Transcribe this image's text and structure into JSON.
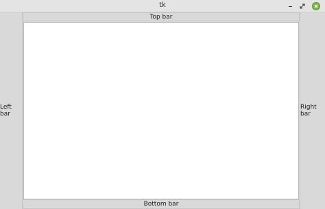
{
  "window": {
    "title": "tk",
    "buttons": {
      "minimize": "minimize",
      "maximize": "maximize",
      "close": "close"
    },
    "icons": {
      "minimize": "minimize-icon",
      "maximize": "maximize-icon",
      "close": "close-icon"
    },
    "colors": {
      "close": "#7cb34a"
    }
  },
  "bars": {
    "top": "Top bar",
    "bottom": "Bottom bar",
    "left": "Left bar",
    "right": "Right bar"
  }
}
